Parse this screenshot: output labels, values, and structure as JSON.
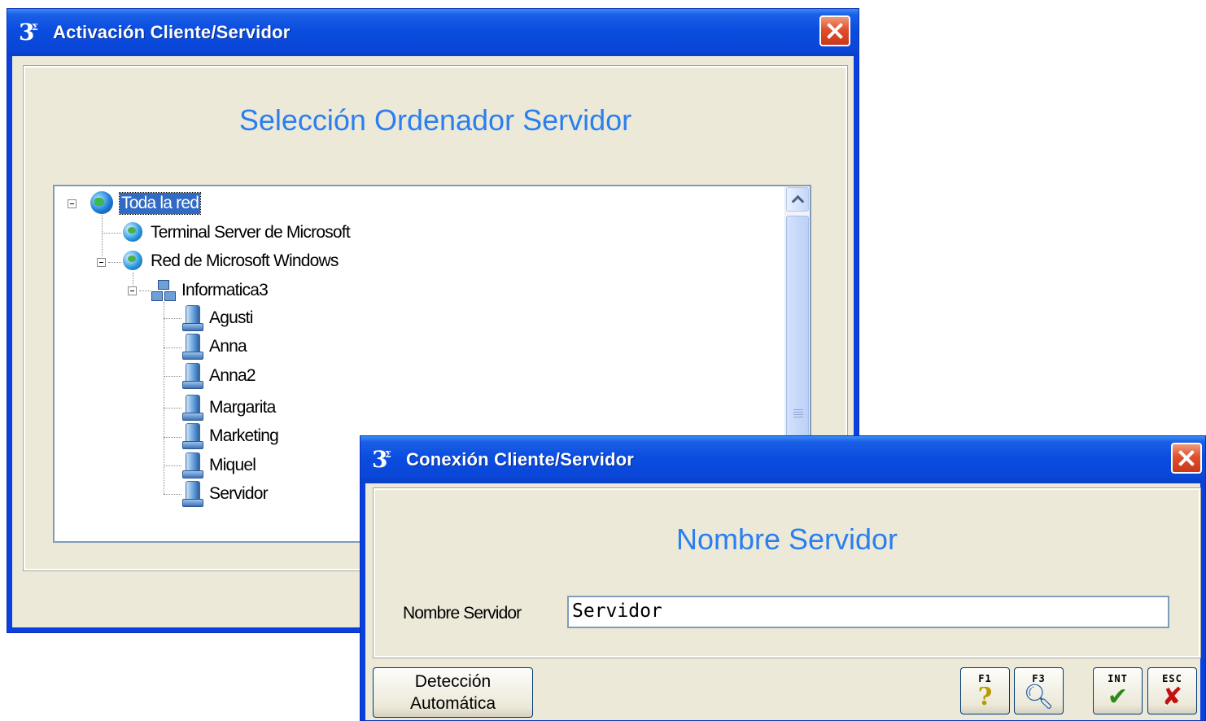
{
  "window_main": {
    "title": "Activación Cliente/Servidor",
    "heading": "Selección Ordenador Servidor",
    "tree": [
      {
        "label": "Toda la red",
        "icon": "globe-icon",
        "selected": true
      },
      {
        "label": "Terminal Server de Microsoft",
        "icon": "network-globe-icon"
      },
      {
        "label": "Red de Microsoft Windows",
        "icon": "network-globe-icon"
      },
      {
        "label": "Informatica3",
        "icon": "workgroup-icon"
      },
      {
        "label": "Agusti",
        "icon": "computer-icon"
      },
      {
        "label": "Anna",
        "icon": "computer-icon"
      },
      {
        "label": "Anna2",
        "icon": "computer-icon"
      },
      {
        "label": "Margarita",
        "icon": "computer-icon"
      },
      {
        "label": "Marketing",
        "icon": "computer-icon"
      },
      {
        "label": "Miquel",
        "icon": "computer-icon"
      },
      {
        "label": "Servidor",
        "icon": "computer-icon"
      }
    ]
  },
  "window_dialog": {
    "title": "Conexión Cliente/Servidor",
    "heading": "Nombre Servidor",
    "field_label": "Nombre Servidor",
    "field_value": "Servidor",
    "buttons": {
      "auto_detect_line1": "Detección",
      "auto_detect_line2": "Automática",
      "f1_key": "F1",
      "f3_key": "F3",
      "int_key": "INT",
      "esc_key": "ESC"
    }
  },
  "colors": {
    "title_bar": "#0a4de0",
    "heading_text": "#2a7ff0",
    "dialog_bg": "#ece9d8",
    "selection": "#316ac5"
  }
}
